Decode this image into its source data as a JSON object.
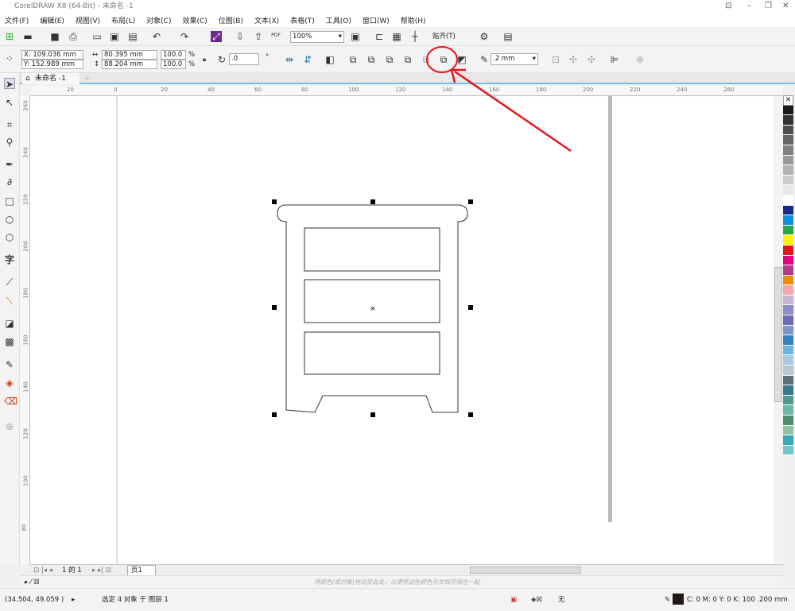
{
  "window": {
    "title": "CorelDRAW X8 (64-Bit) - 未命名 -1"
  },
  "menu": [
    "文件(F)",
    "编辑(E)",
    "视图(V)",
    "布局(L)",
    "对象(C)",
    "效果(C)",
    "位图(B)",
    "文本(X)",
    "表格(T)",
    "工具(O)",
    "窗口(W)",
    "帮助(H)"
  ],
  "toolbar": {
    "zoom": "100%",
    "snap": "贴齐(T)",
    "pdf": "PDF"
  },
  "properties": {
    "x": "X: 109.036 mm",
    "y": "Y: 152.989 mm",
    "width": "80.395 mm",
    "height": "88.204 mm",
    "scale_w": "100.0",
    "scale_h": "100.0",
    "pct": "%",
    "rotation": ".0",
    "degree": "°",
    "outline": ".2 mm"
  },
  "document": {
    "tab": "未命名 -1"
  },
  "ruler": {
    "h": [
      "20",
      "0",
      "20",
      "40",
      "60",
      "80",
      "100",
      "120",
      "140",
      "160",
      "180",
      "200",
      "220",
      "240",
      "260"
    ],
    "v": [
      "260",
      "240",
      "220",
      "200",
      "180",
      "160",
      "140",
      "120",
      "100",
      "80"
    ]
  },
  "pagenav": {
    "page_info": "1 的 1",
    "page_tab": "页1"
  },
  "colorbar": {
    "hint": "将颜色(或对象)拖动至此处，以便将这些颜色与文档存储在一起"
  },
  "status": {
    "coords": "(34.504, 49.059 )",
    "selection": "选定 4 对象 于 图层 1",
    "fill": "无",
    "outline": "C: 0 M: 0 Y: 0 K: 100  .200 mm"
  },
  "annotation_color": "#e8131b",
  "palette": [
    "#1a1a1a",
    "#333333",
    "#4d4d4d",
    "#666666",
    "#808080",
    "#999999",
    "#b3b3b3",
    "#cccccc",
    "#e6e6e6",
    "#ffffff",
    "#1c2a8a",
    "#0f8fd9",
    "#26a84a",
    "#fff100",
    "#e4171d",
    "#e5007e",
    "#b43a8c",
    "#f08c00",
    "#f2a7a8",
    "#c9b3d6",
    "#8d8dc6",
    "#6c6cb5",
    "#7b95c8",
    "#2e84c6",
    "#66b5e4",
    "#a9c9e3",
    "#b3c8d0",
    "#5d6f7a",
    "#3a7a8a",
    "#4f9a8f",
    "#6fb8a7",
    "#4a8e6e",
    "#8fc3a0",
    "#38a9b6",
    "#6fc7c7"
  ]
}
